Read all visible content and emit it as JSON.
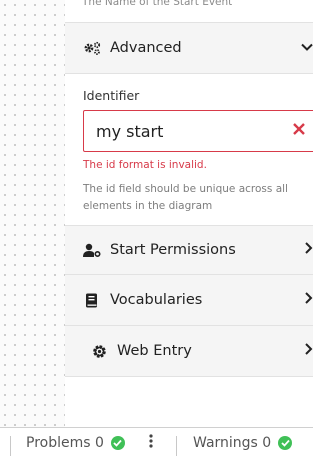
{
  "panel": {
    "top_hint": "The Name of the Start Event",
    "advanced": {
      "label": "Advanced",
      "icon": "gears-icon"
    },
    "identifier": {
      "label": "Identifier",
      "value": "my start",
      "error": "The id format is invalid.",
      "help": "The id field should be unique across all elements in the diagram"
    },
    "sections": [
      {
        "label": "Start Permissions",
        "icon": "user-cog-icon"
      },
      {
        "label": "Vocabularies",
        "icon": "book-icon"
      },
      {
        "label": "Web Entry",
        "icon": "gear-icon"
      }
    ]
  },
  "status_bar": {
    "problems_label": "Problems 0",
    "warnings_label": "Warnings 0"
  },
  "colors": {
    "error": "#d73a49",
    "ok": "#40c057"
  }
}
